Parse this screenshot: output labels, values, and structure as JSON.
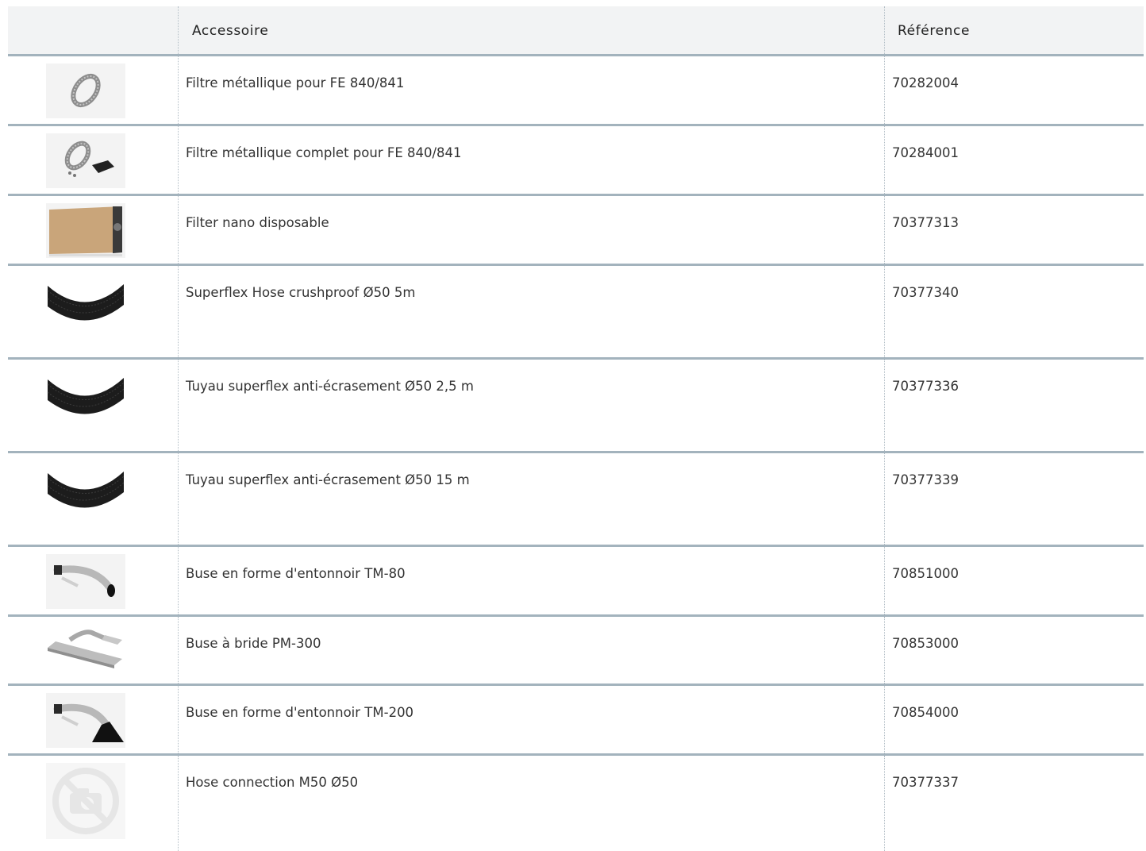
{
  "table": {
    "headers": {
      "image": "",
      "accessory": "Accessoire",
      "reference": "Référence"
    },
    "rows": [
      {
        "icon": "metal-filter-ring-icon",
        "name": "Filtre métallique pour FE 840/841",
        "reference": "70282004"
      },
      {
        "icon": "metal-filter-kit-icon",
        "name": "Filtre métallique complet pour FE 840/841",
        "reference": "70284001"
      },
      {
        "icon": "filter-box-icon",
        "name": "Filter nano disposable",
        "reference": "70377313"
      },
      {
        "icon": "black-hose-icon",
        "name": "Superflex Hose crushproof Ø50 5m",
        "reference": "70377340"
      },
      {
        "icon": "black-hose-icon",
        "name": "Tuyau superflex anti-écrasement Ø50 2,5 m",
        "reference": "70377336"
      },
      {
        "icon": "black-hose-icon",
        "name": "Tuyau superflex anti-écrasement Ø50 15 m",
        "reference": "70377339"
      },
      {
        "icon": "funnel-nozzle-icon",
        "name": "Buse en forme d'entonnoir TM-80",
        "reference": "70851000"
      },
      {
        "icon": "flange-nozzle-icon",
        "name": "Buse à bride PM-300",
        "reference": "70853000"
      },
      {
        "icon": "funnel-nozzle-wide-icon",
        "name": "Buse en forme d'entonnoir TM-200",
        "reference": "70854000"
      },
      {
        "icon": "no-image-placeholder-icon",
        "name": "Hose connection M50 Ø50",
        "reference": "70377337"
      }
    ]
  },
  "colors": {
    "header_background": "#f2f3f4",
    "row_rule": "#a3b3bd",
    "column_separator": "#b3bec6",
    "text": "#333333"
  }
}
